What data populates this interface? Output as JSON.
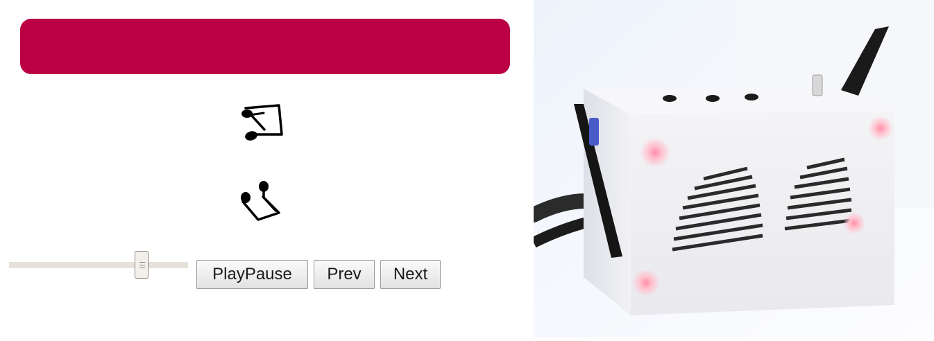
{
  "header": {
    "color": "#bb0044"
  },
  "icons": {
    "note_up": "beamed-eighth-notes-icon",
    "note_down": "inverted-beamed-eighth-notes-icon"
  },
  "volume": {
    "value": 0.76
  },
  "controls": {
    "play_pause_label": "PlayPause",
    "prev_label": "Prev",
    "next_label": "Next"
  },
  "photo": {
    "subject": "speaker-box-photo"
  }
}
